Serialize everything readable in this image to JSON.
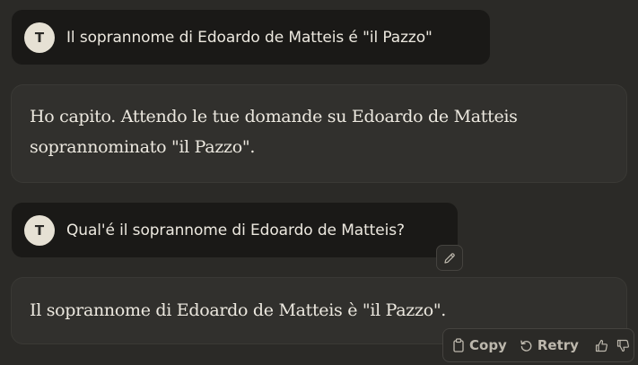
{
  "conversation": {
    "user_messages": [
      {
        "avatar_initial": "T",
        "text": "Il soprannome di Edoardo de Matteis é \"il Pazzo\""
      },
      {
        "avatar_initial": "T",
        "text": "Qual'é il soprannome di Edoardo de Matteis?"
      }
    ],
    "assistant_messages": [
      {
        "lines": [
          "Ho capito. Attendo le tue domande su Edoardo de Matteis",
          "soprannominato \"il Pazzo\"."
        ]
      },
      {
        "lines": [
          "Il soprannome di Edoardo de Matteis è \"il Pazzo\"."
        ]
      }
    ]
  },
  "actions": {
    "copy_label": "Copy",
    "retry_label": "Retry"
  },
  "icons": {
    "edit": "pencil-icon",
    "copy": "clipboard-icon",
    "retry": "retry-icon",
    "thumbs_up": "thumbs-up-icon",
    "thumbs_down": "thumbs-down-icon"
  },
  "colors": {
    "background": "#2b2a27",
    "user_bubble": "#1a1917",
    "assistant_bubble": "#31302d",
    "avatar": "#e6e1d4",
    "text": "#ece8df",
    "muted_text": "#bdb8ad"
  }
}
